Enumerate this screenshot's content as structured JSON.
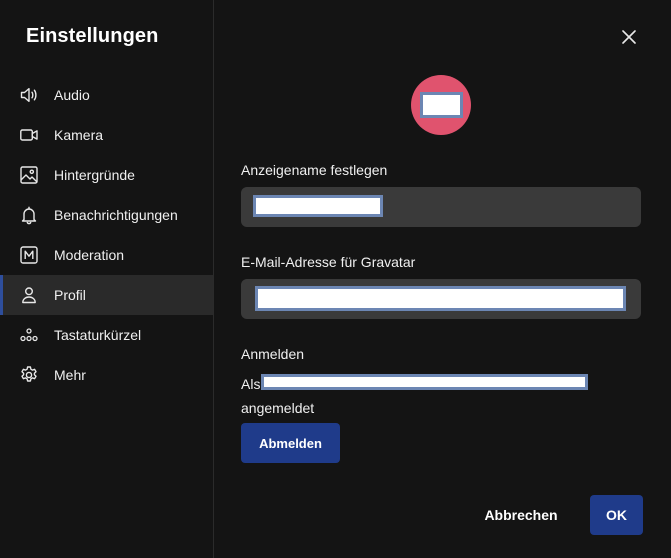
{
  "dialog": {
    "title": "Einstellungen"
  },
  "sidebar": {
    "items": [
      {
        "label": "Audio",
        "icon": "speaker-icon"
      },
      {
        "label": "Kamera",
        "icon": "camera-icon"
      },
      {
        "label": "Hintergründe",
        "icon": "image-icon"
      },
      {
        "label": "Benachrichtigungen",
        "icon": "bell-icon"
      },
      {
        "label": "Moderation",
        "icon": "moderation-icon"
      },
      {
        "label": "Profil",
        "icon": "user-icon",
        "active": true
      },
      {
        "label": "Tastaturkürzel",
        "icon": "keyboard-shortcuts-icon"
      },
      {
        "label": "Mehr",
        "icon": "gear-icon"
      }
    ]
  },
  "profile": {
    "display_name_label": "Anzeigename festlegen",
    "email_label": "E-Mail-Adresse für Gravatar",
    "login_heading": "Anmelden",
    "signed_in_prefix": "Als",
    "signed_in_suffix": "angemeldet",
    "logout_label": "Abmelden"
  },
  "footer": {
    "cancel_label": "Abbrechen",
    "ok_label": "OK"
  },
  "colors": {
    "accent": "#1f3b8a",
    "avatar": "#e0536e",
    "active_indicator": "#2e4e9c"
  }
}
